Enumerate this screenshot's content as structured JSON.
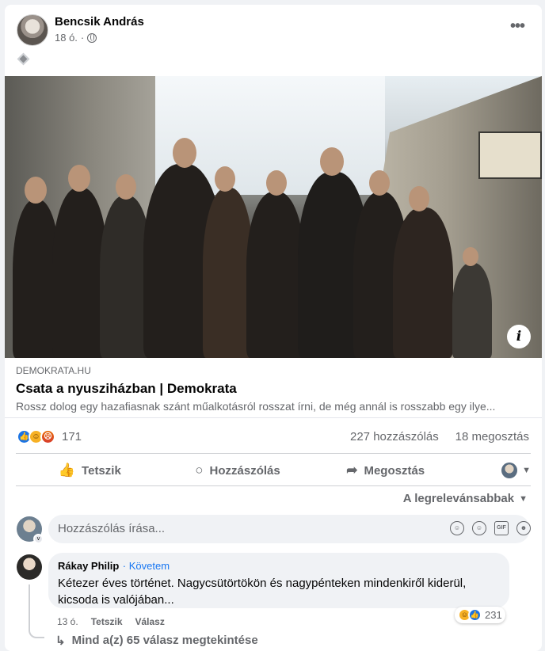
{
  "post": {
    "author": "Bencsik András",
    "time": "18 ó.",
    "more_label": "•••",
    "emoji_icon": "diamond-icon"
  },
  "link_preview": {
    "domain": "DEMOKRATA.HU",
    "title": "Csata a nyusziházban | Demokrata",
    "description": "Rossz dolog egy hazafiasnak szánt műalkotásról rosszat írni, de még annál is rosszabb egy ilye..."
  },
  "stats": {
    "reaction_count": "171",
    "comments": "227 hozzászólás",
    "shares": "18 megosztás"
  },
  "actions": {
    "like": "Tetszik",
    "comment": "Hozzászólás",
    "share": "Megosztás"
  },
  "sort": {
    "label": "A legrelevánsabbak"
  },
  "composer": {
    "placeholder": "Hozzászólás írása..."
  },
  "comment": {
    "name": "Rákay Philip",
    "follow": "Követem",
    "text": "Kétezer éves történet. Nagycsütörtökön és nagypénteken mindenkiről kiderül, kicsoda is valójában...",
    "time": "13 ó.",
    "like": "Tetszik",
    "reply": "Válasz",
    "reaction_count": "231",
    "view_replies": "Mind a(z) 65 válasz megtekintése"
  },
  "colors": {
    "accent": "#1877f2",
    "secondary_text": "#65676b"
  }
}
